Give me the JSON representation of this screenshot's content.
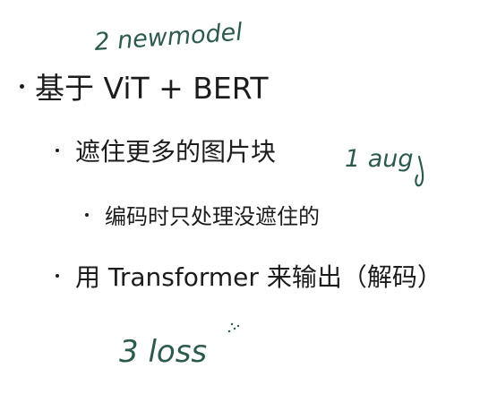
{
  "bullets": {
    "level1": "基于 ViT + BERT",
    "level2_a": "遮住更多的图片块",
    "level3": "编码时只处理没遮住的",
    "level2_b": "用 Transformer 来输出（解码）"
  },
  "annotations": {
    "note_top": "2 newmodel",
    "note_right": "1 aug",
    "note_bottom": "3 loss"
  },
  "colors": {
    "text": "#1c1c1c",
    "ink": "#2c5a4e",
    "background": "#ffffff"
  }
}
